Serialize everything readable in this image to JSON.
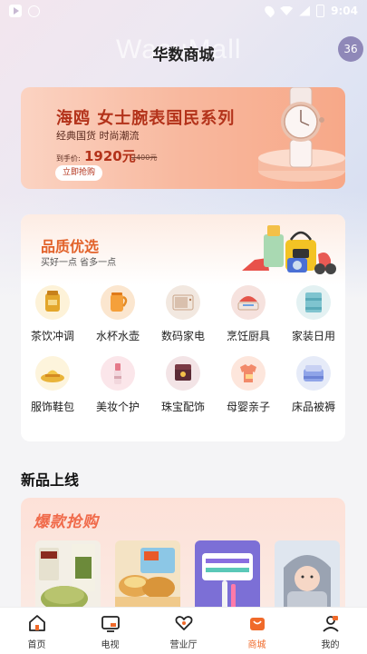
{
  "status_bar": {
    "time": "9:04"
  },
  "header": {
    "watermark": "WasuMall",
    "title": "华数商城",
    "avatar_badge": "36"
  },
  "banner": {
    "title": "海鸥 女士腕表国民系列",
    "subtitle": "经典国货 时尚潮流",
    "price_label": "到手价:",
    "price": "1920元",
    "old_price": "2400元",
    "button_label": "立即抢购"
  },
  "quality": {
    "title": "品质优选",
    "subtitle": "买好一点 省多一点",
    "categories": [
      {
        "label": "茶饮冲调",
        "icon": "tea-icon"
      },
      {
        "label": "水杯水壶",
        "icon": "kettle-icon"
      },
      {
        "label": "数码家电",
        "icon": "microwave-icon"
      },
      {
        "label": "烹饪厨具",
        "icon": "cookware-icon"
      },
      {
        "label": "家装日用",
        "icon": "towel-icon"
      },
      {
        "label": "服饰鞋包",
        "icon": "hat-icon"
      },
      {
        "label": "美妆个护",
        "icon": "cosmetics-icon"
      },
      {
        "label": "珠宝配饰",
        "icon": "jewelry-box-icon"
      },
      {
        "label": "母婴亲子",
        "icon": "baby-clothes-icon"
      },
      {
        "label": "床品被褥",
        "icon": "bedding-icon"
      }
    ]
  },
  "new_arrivals": {
    "title": "新品上线",
    "hot_title": "爆款抢购"
  },
  "bottom_nav": [
    {
      "label": "首页",
      "icon": "home-icon"
    },
    {
      "label": "电视",
      "icon": "tv-icon"
    },
    {
      "label": "营业厅",
      "icon": "heart-hand-icon"
    },
    {
      "label": "商城",
      "icon": "shop-bag-icon",
      "active": true
    },
    {
      "label": "我的",
      "icon": "profile-icon"
    }
  ],
  "colors": {
    "accent": "#f06a2a",
    "banner_text": "#b3321a",
    "quality_title": "#e2622a"
  }
}
